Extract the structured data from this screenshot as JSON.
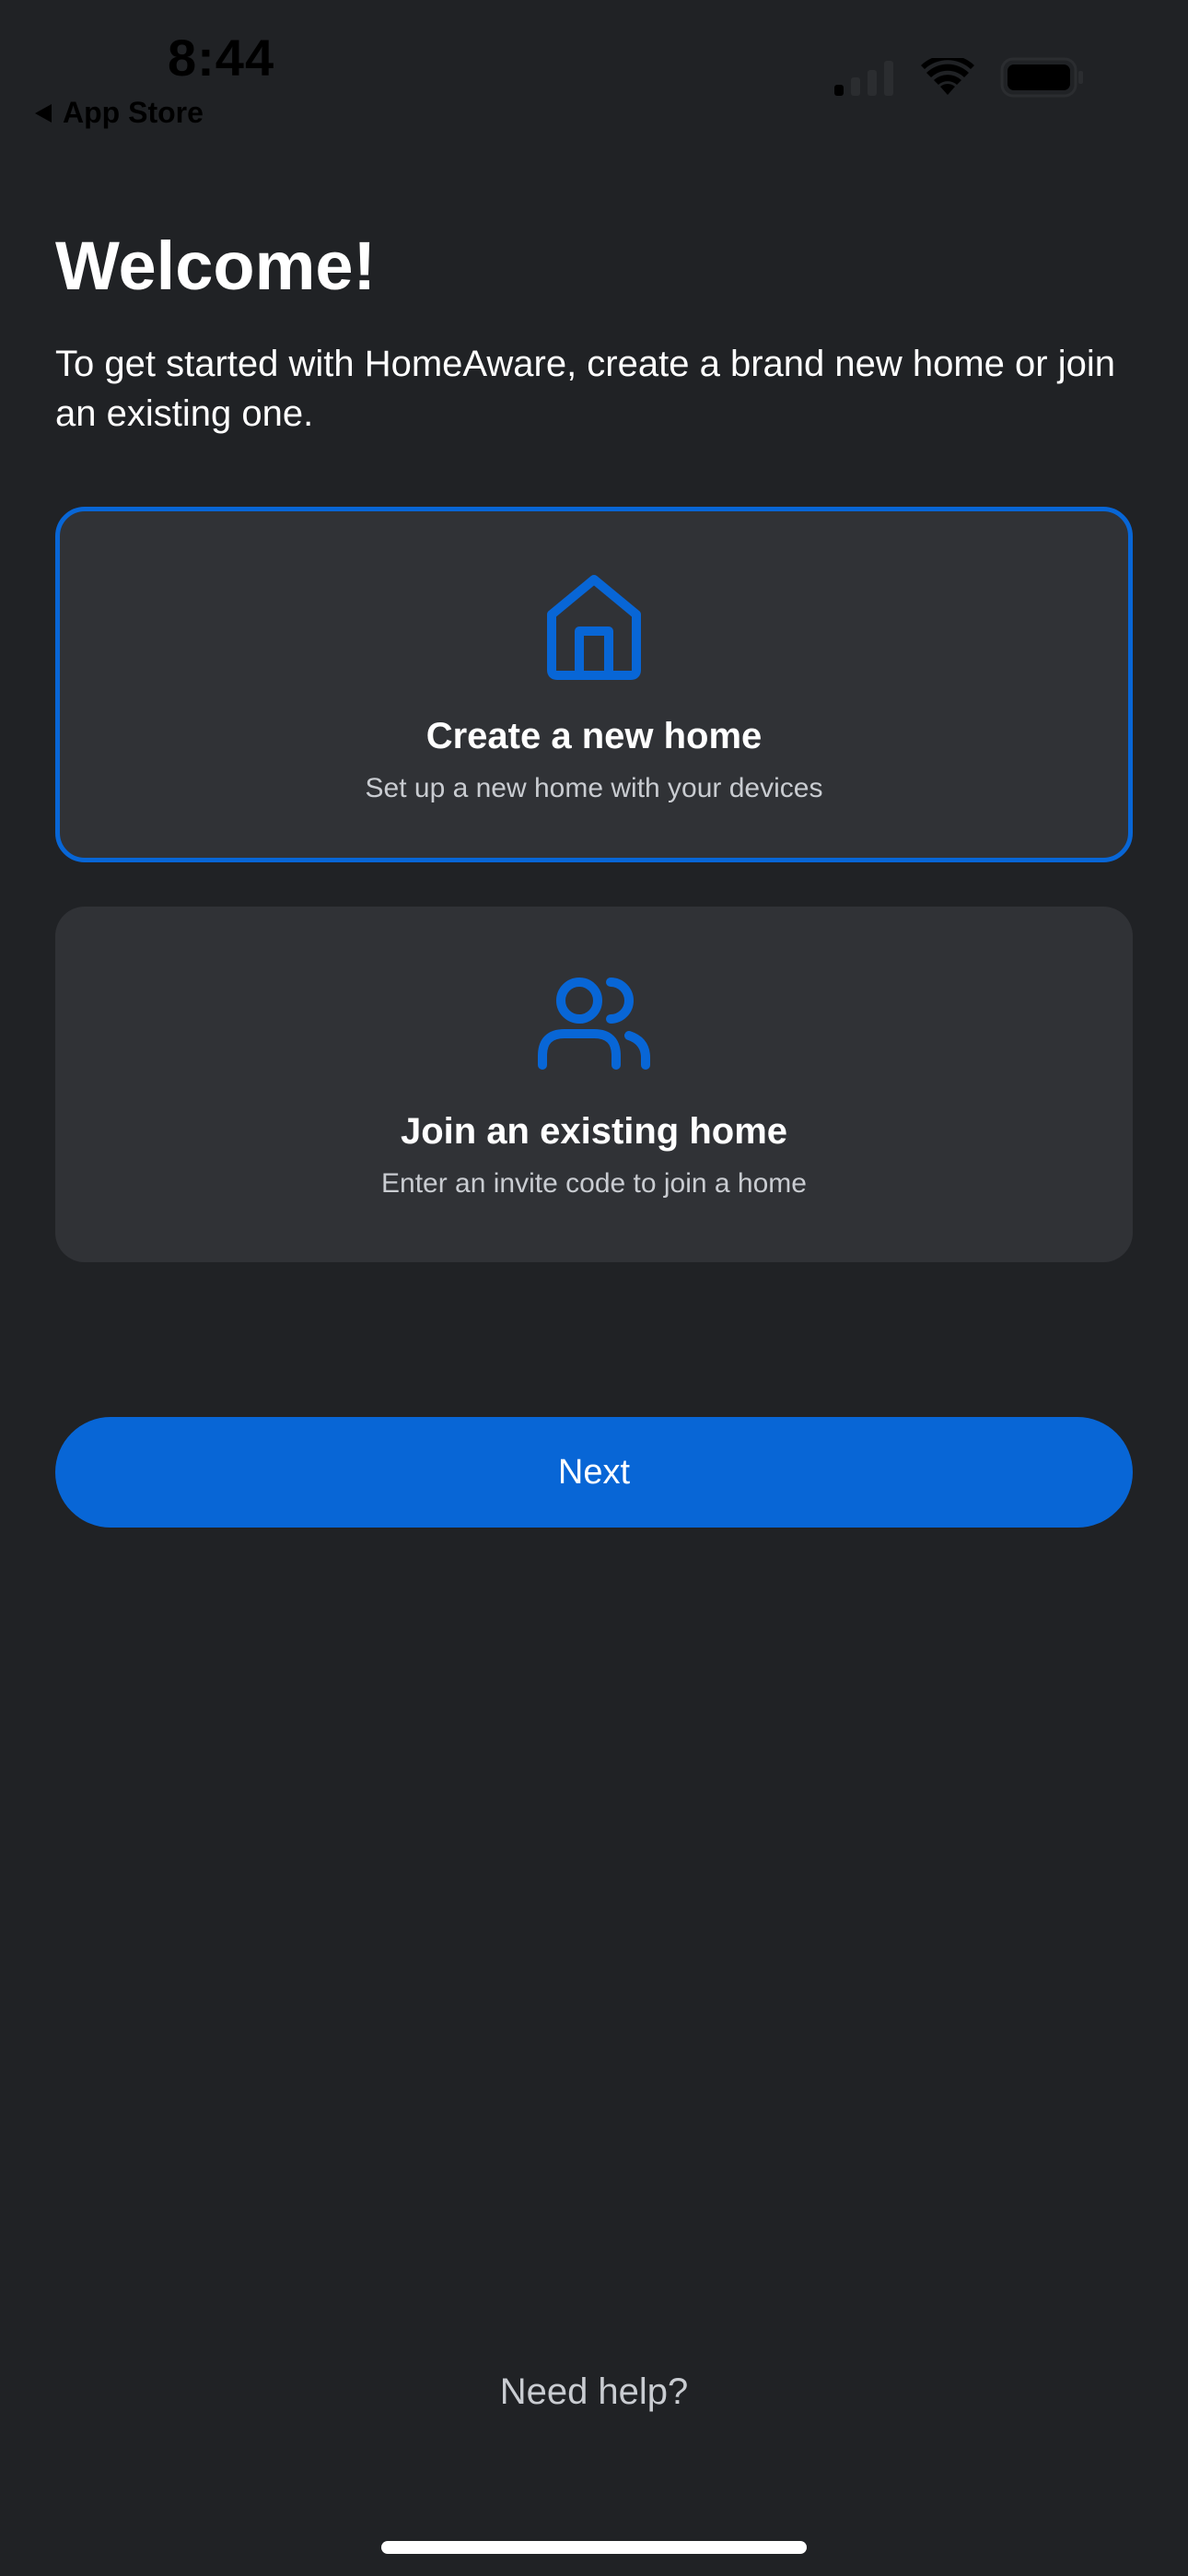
{
  "status_bar": {
    "time": "8:44",
    "back_label": "App Store",
    "icons": [
      "cellular-signal-icon",
      "wifi-icon",
      "battery-icon"
    ]
  },
  "header": {
    "title": "Welcome!",
    "subtitle": "To get started with HomeAware, create a brand new home or join an existing one."
  },
  "options": [
    {
      "icon": "house-icon",
      "title": "Create a new home",
      "description": "Set up a new home with your devices",
      "selected": true
    },
    {
      "icon": "users-icon",
      "title": "Join an existing home",
      "description": "Enter an invite code to join a home",
      "selected": false
    }
  ],
  "actions": {
    "next_label": "Next",
    "help_label": "Need help?"
  },
  "colors": {
    "background": "#202225",
    "card": "#303236",
    "accent": "#0866d6",
    "text_primary": "#ffffff",
    "text_secondary": "#c9ccd1"
  }
}
